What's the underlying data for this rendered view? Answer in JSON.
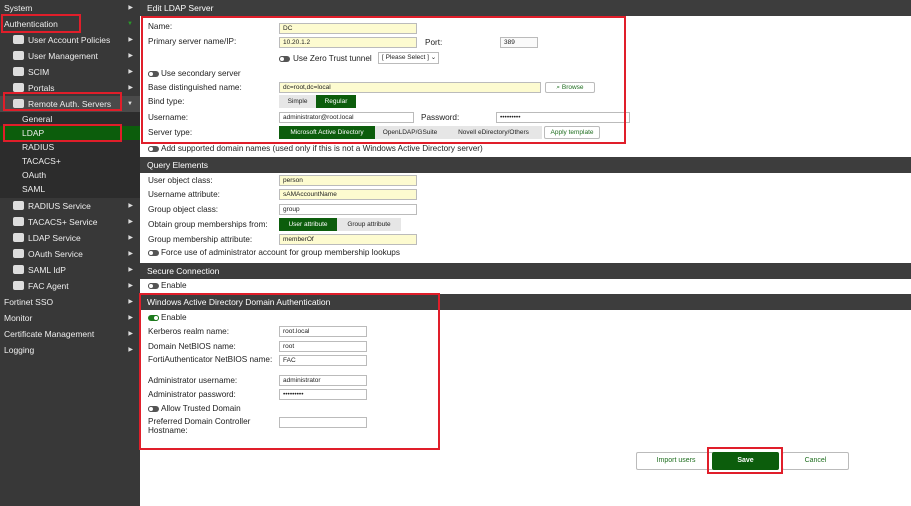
{
  "sidebar": {
    "items": [
      {
        "label": "System"
      },
      {
        "label": "Authentication"
      },
      {
        "label": "User Account Policies"
      },
      {
        "label": "User Management"
      },
      {
        "label": "SCIM"
      },
      {
        "label": "Portals"
      },
      {
        "label": "Remote Auth. Servers"
      },
      {
        "label": "General"
      },
      {
        "label": "LDAP"
      },
      {
        "label": "RADIUS"
      },
      {
        "label": "TACACS+"
      },
      {
        "label": "OAuth"
      },
      {
        "label": "SAML"
      },
      {
        "label": "RADIUS Service"
      },
      {
        "label": "TACACS+ Service"
      },
      {
        "label": "LDAP Service"
      },
      {
        "label": "OAuth Service"
      },
      {
        "label": "SAML IdP"
      },
      {
        "label": "FAC Agent"
      },
      {
        "label": "Fortinet SSO"
      },
      {
        "label": "Monitor"
      },
      {
        "label": "Certificate Management"
      },
      {
        "label": "Logging"
      }
    ]
  },
  "ldap": {
    "title": "Edit LDAP Server",
    "name_label": "Name:",
    "name": "DC",
    "primary_label": "Primary server name/IP:",
    "primary": "10.20.1.2",
    "port_label": "Port:",
    "port": "389",
    "zero_trust": "Use Zero Trust tunnel",
    "zero_trust_select": "[ Please Select ]",
    "secondary": "Use secondary server",
    "base_dn_label": "Base distinguished name:",
    "base_dn": "dc=root,dc=local",
    "browse": "Browse",
    "bind_label": "Bind type:",
    "bind_options": [
      "Simple",
      "Regular"
    ],
    "bind_selected": "Regular",
    "username_label": "Username:",
    "username": "administrator@root.local",
    "password_label": "Password:",
    "password": "•••••••••",
    "server_type_label": "Server type:",
    "server_types": [
      "Microsoft Active Directory",
      "OpenLDAP/GSuite",
      "Novell eDirectory/Others"
    ],
    "server_type_selected": "Microsoft Active Directory",
    "apply_template": "Apply template",
    "add_domains": "Add supported domain names (used only if this is not a Windows Active Directory server)"
  },
  "query": {
    "title": "Query Elements",
    "user_class_label": "User object class:",
    "user_class": "person",
    "user_attr_label": "Username attribute:",
    "user_attr": "sAMAccountName",
    "group_class_label": "Group object class:",
    "group_class": "group",
    "obtain_label": "Obtain group memberships from:",
    "obtain_options": [
      "User attribute",
      "Group attribute"
    ],
    "obtain_selected": "User attribute",
    "membership_label": "Group membership attribute:",
    "membership": "memberOf",
    "force_admin": "Force use of administrator account for group membership lookups"
  },
  "secure": {
    "title": "Secure Connection",
    "enable": "Enable"
  },
  "winad": {
    "title": "Windows Active Directory Domain Authentication",
    "enable": "Enable",
    "kerberos_label": "Kerberos realm name:",
    "kerberos": "root.local",
    "netbios_label": "Domain NetBIOS name:",
    "netbios": "root",
    "fac_netbios_label": "FortiAuthenticator NetBIOS name:",
    "fac_netbios": "FAC",
    "admin_user_label": "Administrator username:",
    "admin_user": "administrator",
    "admin_pw_label": "Administrator password:",
    "admin_pw": "•••••••••",
    "allow_trusted": "Allow Trusted Domain",
    "preferred_dc_label": "Preferred Domain Controller Hostname:",
    "preferred_dc": ""
  },
  "footer": {
    "import": "Import users",
    "save": "Save",
    "cancel": "Cancel"
  },
  "colors": {
    "accent": "#0c5d0c",
    "highlight": "#e01e2a"
  }
}
